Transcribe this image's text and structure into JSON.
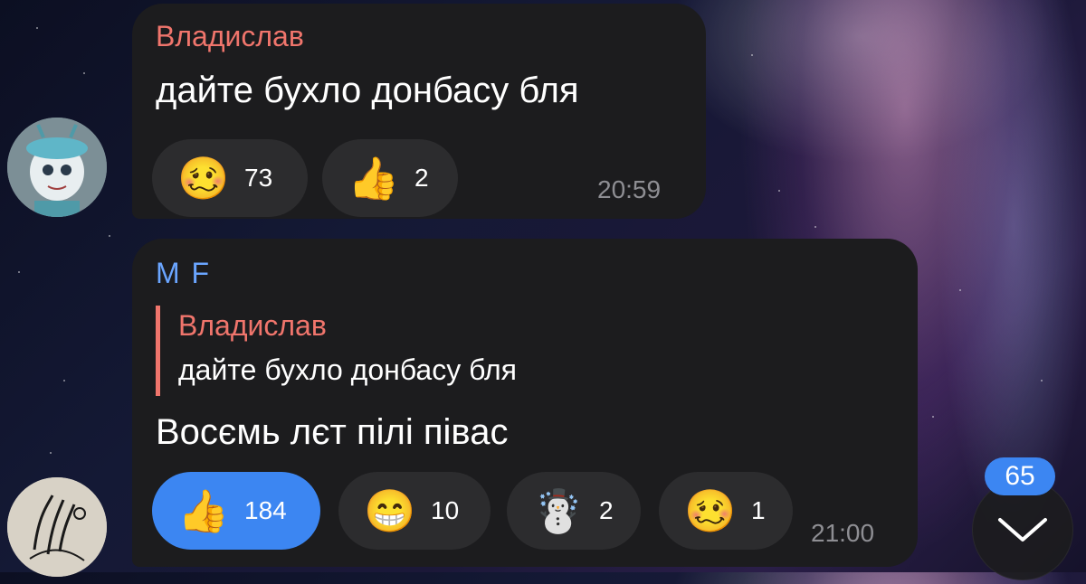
{
  "colors": {
    "bubble": "#1c1c1e",
    "chip": "#2c2c2e",
    "accent_blue": "#3c86f2",
    "sender_red": "#f0756c",
    "sender_blue": "#6aa5ff",
    "time_gray": "#8e8e93"
  },
  "messages": [
    {
      "sender": "Владислав",
      "text": "дайте бухло донбасу бля",
      "time": "20:59",
      "reactions": [
        {
          "emoji": "🥴",
          "count": "73",
          "selected": false
        },
        {
          "emoji": "👍",
          "count": "2",
          "selected": false
        }
      ]
    },
    {
      "sender": "M F",
      "reply": {
        "name": "Владислав",
        "text": "дайте бухло донбасу бля"
      },
      "text": "Восємь лєт пілі півас",
      "time": "21:00",
      "reactions": [
        {
          "emoji": "👍",
          "count": "184",
          "selected": true
        },
        {
          "emoji": "😁",
          "count": "10",
          "selected": false
        },
        {
          "emoji": "☃️",
          "count": "2",
          "selected": false
        },
        {
          "emoji": "🥴",
          "count": "1",
          "selected": false
        }
      ]
    }
  ],
  "scroll_down": {
    "badge": "65",
    "icon": "chevron-down-icon"
  }
}
